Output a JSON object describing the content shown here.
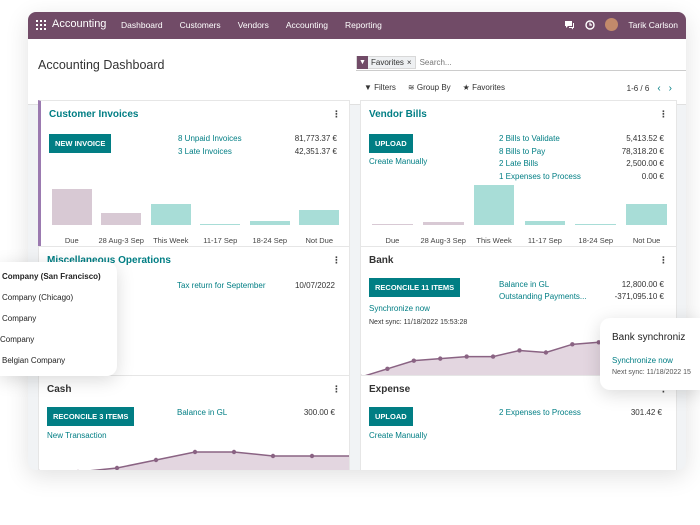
{
  "topbar": {
    "app_name": "Accounting",
    "nav": [
      "Dashboard",
      "Customers",
      "Vendors",
      "Accounting",
      "Reporting"
    ],
    "user": "Tarik Carlson",
    "company_label": "Y Company"
  },
  "control": {
    "title": "Accounting Dashboard",
    "facet": "Favorites",
    "search_placeholder": "Search...",
    "filters": "Filters",
    "group_by": "Group By",
    "favorites": "Favorites",
    "pager": "1-6 / 6"
  },
  "customer_invoices": {
    "title": "Customer Invoices",
    "button": "NEW INVOICE",
    "lines": [
      {
        "label": "8 Unpaid Invoices",
        "amount": "81,773.37 €"
      },
      {
        "label": "3 Late Invoices",
        "amount": "42,351.37 €"
      }
    ],
    "chart_labels": [
      "Due",
      "28 Aug-3 Sep",
      "This Week",
      "11-17 Sep",
      "18-24 Sep",
      "Not Due"
    ]
  },
  "vendor_bills": {
    "title": "Vendor Bills",
    "button": "UPLOAD",
    "create": "Create Manually",
    "lines": [
      {
        "label": "2 Bills to Validate",
        "amount": "5,413.52 €"
      },
      {
        "label": "8 Bills to Pay",
        "amount": "78,318.20 €"
      },
      {
        "label": "2 Late Bills",
        "amount": "2,500.00 €"
      },
      {
        "label": "1 Expenses to Process",
        "amount": "0.00 €"
      }
    ],
    "chart_labels": [
      "Due",
      "28 Aug-3 Sep",
      "This Week",
      "11-17 Sep",
      "18-24 Sep",
      "Not Due"
    ]
  },
  "misc": {
    "title": "Miscellaneous Operations",
    "entry": "Tax return for September",
    "date": "10/07/2022"
  },
  "bank": {
    "title": "Bank",
    "button": "RECONCILE 11 ITEMS",
    "sync": "Synchronize now",
    "next_sync": "Next sync: 11/18/2022 15:53:28",
    "lines": [
      {
        "label": "Balance in GL",
        "amount": "12,800.00 €"
      },
      {
        "label": "Outstanding Payments...",
        "amount": "-371,095.10 €"
      }
    ]
  },
  "cash": {
    "title": "Cash",
    "button": "RECONCILE 3 ITEMS",
    "create": "New Transaction",
    "lines": [
      {
        "label": "Balance in GL",
        "amount": "300.00 €"
      }
    ]
  },
  "expense": {
    "title": "Expense",
    "button": "UPLOAD",
    "create": "Create Manually",
    "lines": [
      {
        "label": "2 Expenses to Process",
        "amount": "301.42 €"
      }
    ]
  },
  "company_dropdown": [
    "Company (San Francisco)",
    "Company (Chicago)",
    "Company",
    "Company",
    "Belgian Company"
  ],
  "bank_popup": {
    "title": "Bank synchroniz",
    "link": "Synchronize now",
    "next": "Next sync: 11/18/2022 15"
  },
  "colors": {
    "brand": "#714B67",
    "teal": "#017e84",
    "bar_past": "#d8c9d4",
    "bar_current": "#a8ddd7"
  },
  "chart_data": [
    {
      "type": "bar",
      "categories": [
        "Due",
        "28 Aug-3 Sep",
        "This Week",
        "11-17 Sep",
        "18-24 Sep",
        "Not Due"
      ],
      "values": [
        24,
        8,
        14,
        1,
        3,
        10
      ]
    },
    {
      "type": "bar",
      "categories": [
        "Due",
        "28 Aug-3 Sep",
        "This Week",
        "11-17 Sep",
        "18-24 Sep",
        "Not Due"
      ],
      "values": [
        0,
        2,
        27,
        3,
        0,
        14
      ]
    },
    {
      "type": "area",
      "values": [
        0,
        4,
        8,
        9,
        10,
        10,
        13,
        12,
        16,
        17,
        22,
        23,
        23
      ]
    },
    {
      "type": "area",
      "values": [
        0,
        0,
        2,
        6,
        10,
        10,
        8,
        8,
        8
      ]
    }
  ]
}
